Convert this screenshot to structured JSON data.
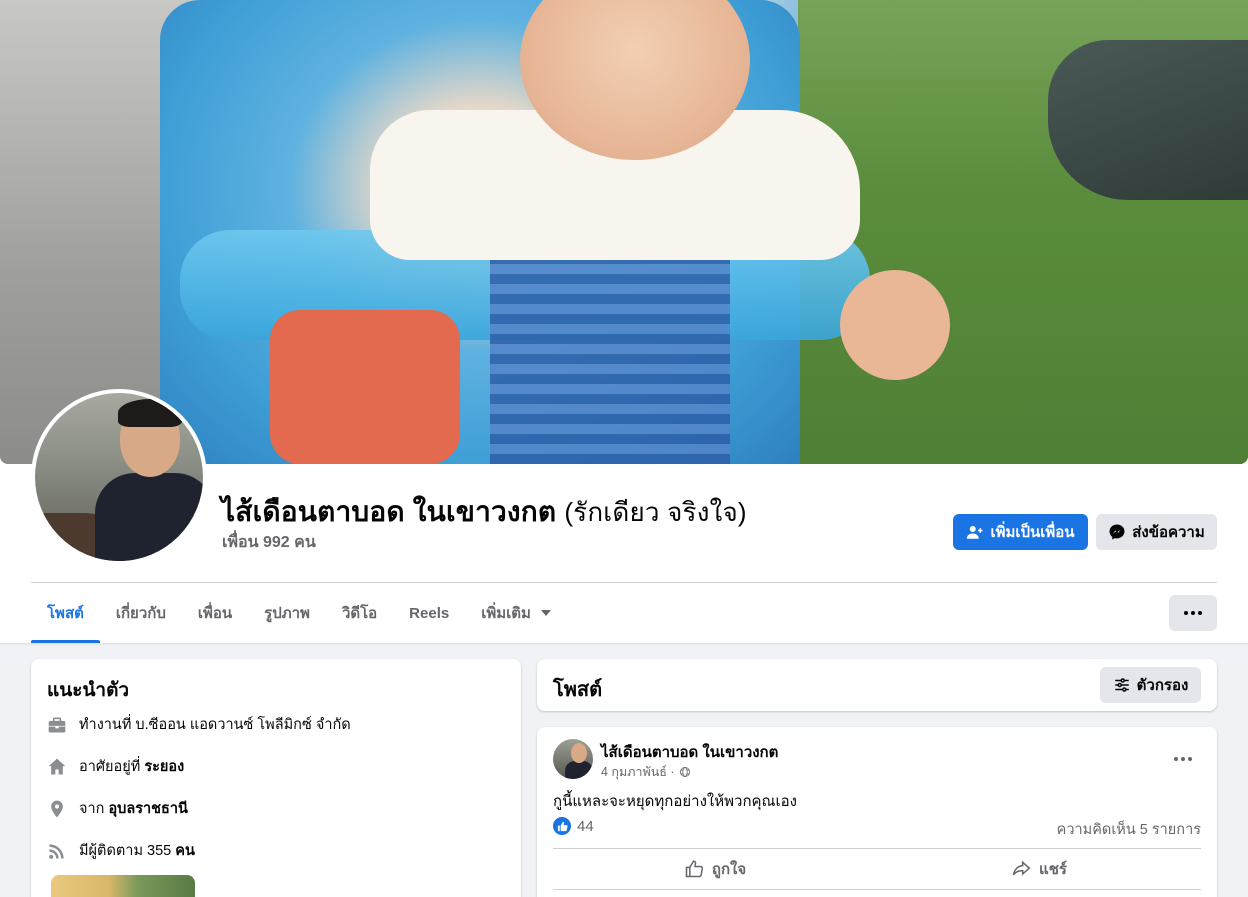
{
  "profile": {
    "name": "ไส้เดือนตาบอด ในเขาวงกต",
    "nickname": "(รักเดียว จริงใจ)",
    "friends_count": "เพื่อน 992 คน"
  },
  "actions": {
    "add_friend": "เพิ่มเป็นเพื่อน",
    "message": "ส่งข้อความ"
  },
  "tabs": [
    {
      "label": "โพสต์",
      "active": true
    },
    {
      "label": "เกี่ยวกับ"
    },
    {
      "label": "เพื่อน"
    },
    {
      "label": "รูปภาพ"
    },
    {
      "label": "วิดีโอ"
    },
    {
      "label": "Reels"
    },
    {
      "label": "เพิ่มเติม"
    }
  ],
  "intro": {
    "title": "แนะนำตัว",
    "work": "ทำงานที่ บ.ซีออน แอดวานซ์ โพลีมิกซ์ จำกัด",
    "lives_prefix": "อาศัยอยู่ที่",
    "lives_value": "ระยอง",
    "from_prefix": "จาก",
    "from_value": "อุบลราชธานี",
    "followers_prefix": "มีผู้ติดตาม 355",
    "followers_value": "คน"
  },
  "posts_section": {
    "title": "โพสต์",
    "filter_label": "ตัวกรอง"
  },
  "post": {
    "author": "ไส้เดือนตาบอด ในเขาวงกต",
    "date": "4 กุมภาพันธ์ ·",
    "text": "กูนี้แหละจะหยุดทุกอย่างให้พวกคุณเอง",
    "likes": "44",
    "comments": "ความคิดเห็น 5 รายการ",
    "like_label": "ถูกใจ",
    "share_label": "แชร์"
  },
  "colors": {
    "accent": "#1b74e4",
    "background": "#f0f2f5",
    "secondary_text": "#65676b"
  }
}
